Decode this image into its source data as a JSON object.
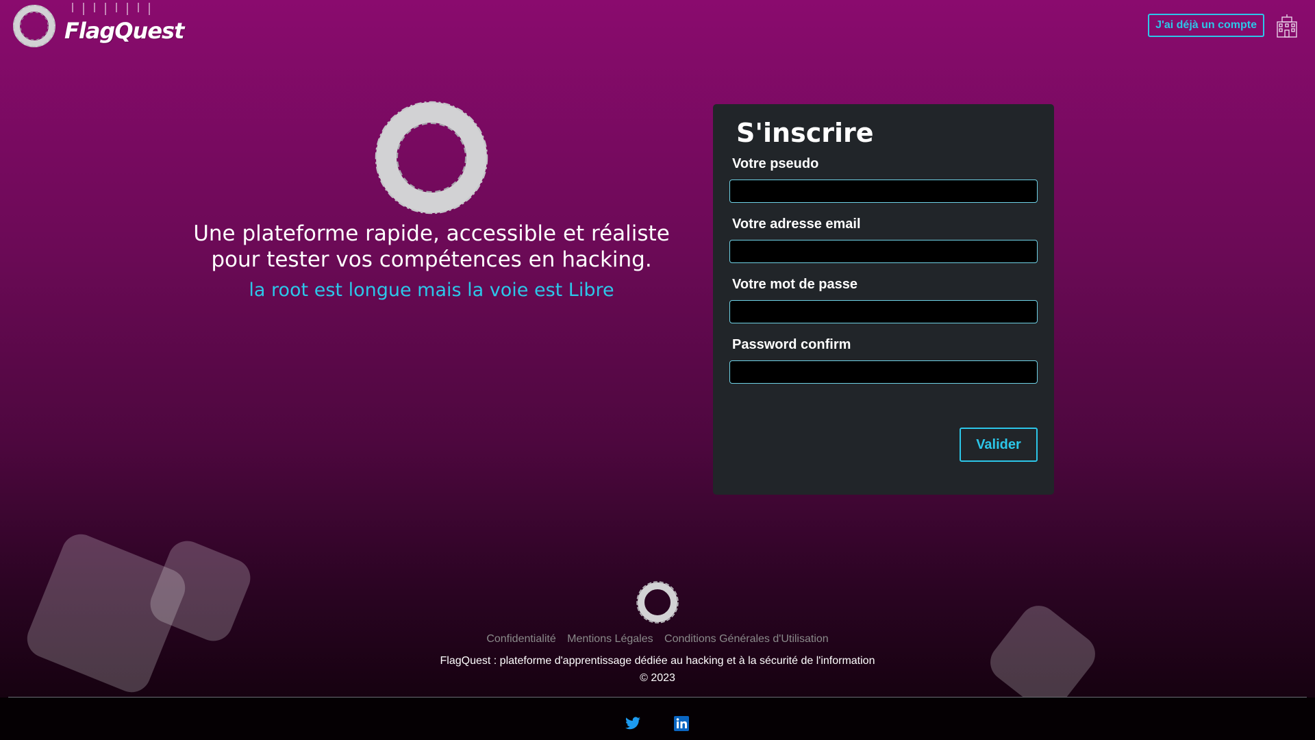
{
  "header": {
    "brand_name": "FlagQuest",
    "login_button": "J'ai déjà un compte"
  },
  "hero": {
    "title_line1": "Une plateforme rapide, accessible et réaliste",
    "title_line2": "pour tester vos compétences en hacking.",
    "tagline": "la root est longue mais la voie est Libre"
  },
  "form": {
    "title": "S'inscrire",
    "fields": [
      {
        "label": "Votre pseudo",
        "value": ""
      },
      {
        "label": "Votre adresse email",
        "value": ""
      },
      {
        "label": "Votre mot de passe",
        "value": ""
      },
      {
        "label": "Password confirm",
        "value": ""
      }
    ],
    "submit": "Valider"
  },
  "footer": {
    "links": [
      "Confidentialité",
      "Mentions Légales",
      "Conditions Générales d'Utilisation"
    ],
    "description": "FlagQuest : plateforme d'apprentissage dédiée au hacking et à la sécurité de l'information",
    "copyright": "© 2023"
  },
  "social": [
    {
      "name": "twitter",
      "icon": "twitter-icon"
    },
    {
      "name": "linkedin",
      "icon": "linkedin-icon"
    }
  ],
  "colors": {
    "accent": "#2cc7e9",
    "card": "#212529",
    "background_top": "#8a0b6e",
    "background_bottom": "#0e0109"
  }
}
